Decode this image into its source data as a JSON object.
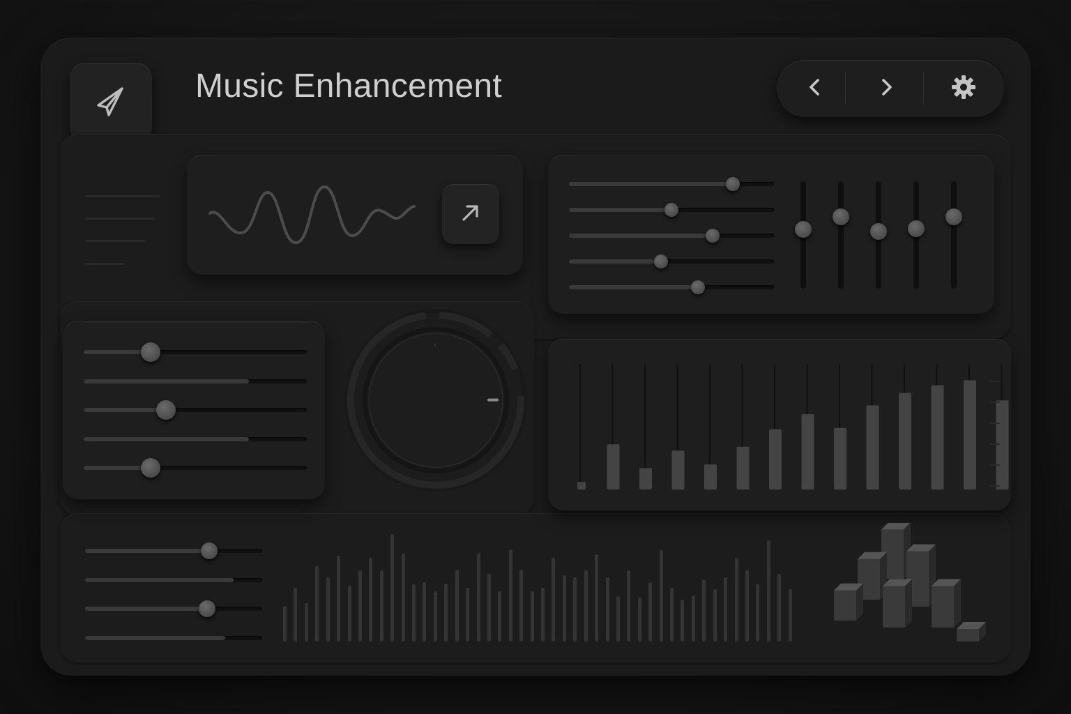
{
  "app": {
    "title": "Music Enhancement"
  },
  "icons": {
    "logo": "send-icon",
    "back": "chevron-left-icon",
    "forward": "chevron-right-icon",
    "settings": "gear-icon",
    "expand": "arrow-up-right-icon",
    "waveform": "waveform-icon",
    "dial": "dial-knob"
  },
  "colors": {
    "background": "#141414",
    "panel": "#1c1c1c",
    "accent": "#5a5a5a",
    "text": "#cfcfcf"
  },
  "equalizer_horizontal": {
    "levels": [
      0.8,
      0.5,
      0.7,
      0.45,
      0.63
    ]
  },
  "equalizer_vertical": {
    "levels": [
      0.55,
      0.67,
      0.53,
      0.56,
      0.67
    ]
  },
  "left_sliders": {
    "levels": [
      0.3,
      0.74,
      0.37,
      0.74,
      0.3
    ]
  },
  "bottom_sliders": {
    "levels": [
      0.7,
      0.84,
      0.69,
      0.79
    ]
  },
  "master_dial": {
    "level": 0.78
  },
  "chart_data": {
    "type": "bar",
    "series": [
      {
        "values": [
          0.06,
          0.36,
          0.17,
          0.31,
          0.2,
          0.34,
          0.48,
          0.6,
          0.49,
          0.67,
          0.77,
          0.83,
          0.87,
          0.71
        ]
      }
    ],
    "ylim": [
      0,
      1
    ],
    "grid": true
  },
  "spectrum_bottom": {
    "levels": [
      0.33,
      0.5,
      0.36,
      0.7,
      0.6,
      0.8,
      0.52,
      0.66,
      0.78,
      0.66,
      1.0,
      0.82,
      0.53,
      0.55,
      0.47,
      0.54,
      0.67,
      0.5,
      0.82,
      0.63,
      0.47,
      0.86,
      0.67,
      0.47,
      0.5,
      0.78,
      0.62,
      0.6,
      0.66,
      0.81,
      0.6,
      0.42,
      0.66,
      0.41,
      0.55,
      0.85,
      0.5,
      0.39,
      0.43,
      0.58,
      0.49,
      0.6,
      0.78,
      0.66,
      0.53,
      0.94,
      0.63,
      0.49
    ]
  },
  "cluster_3d": {
    "heights": [
      0.35,
      0.6,
      1.0,
      0.45,
      0.75,
      0.45,
      0.2
    ]
  }
}
